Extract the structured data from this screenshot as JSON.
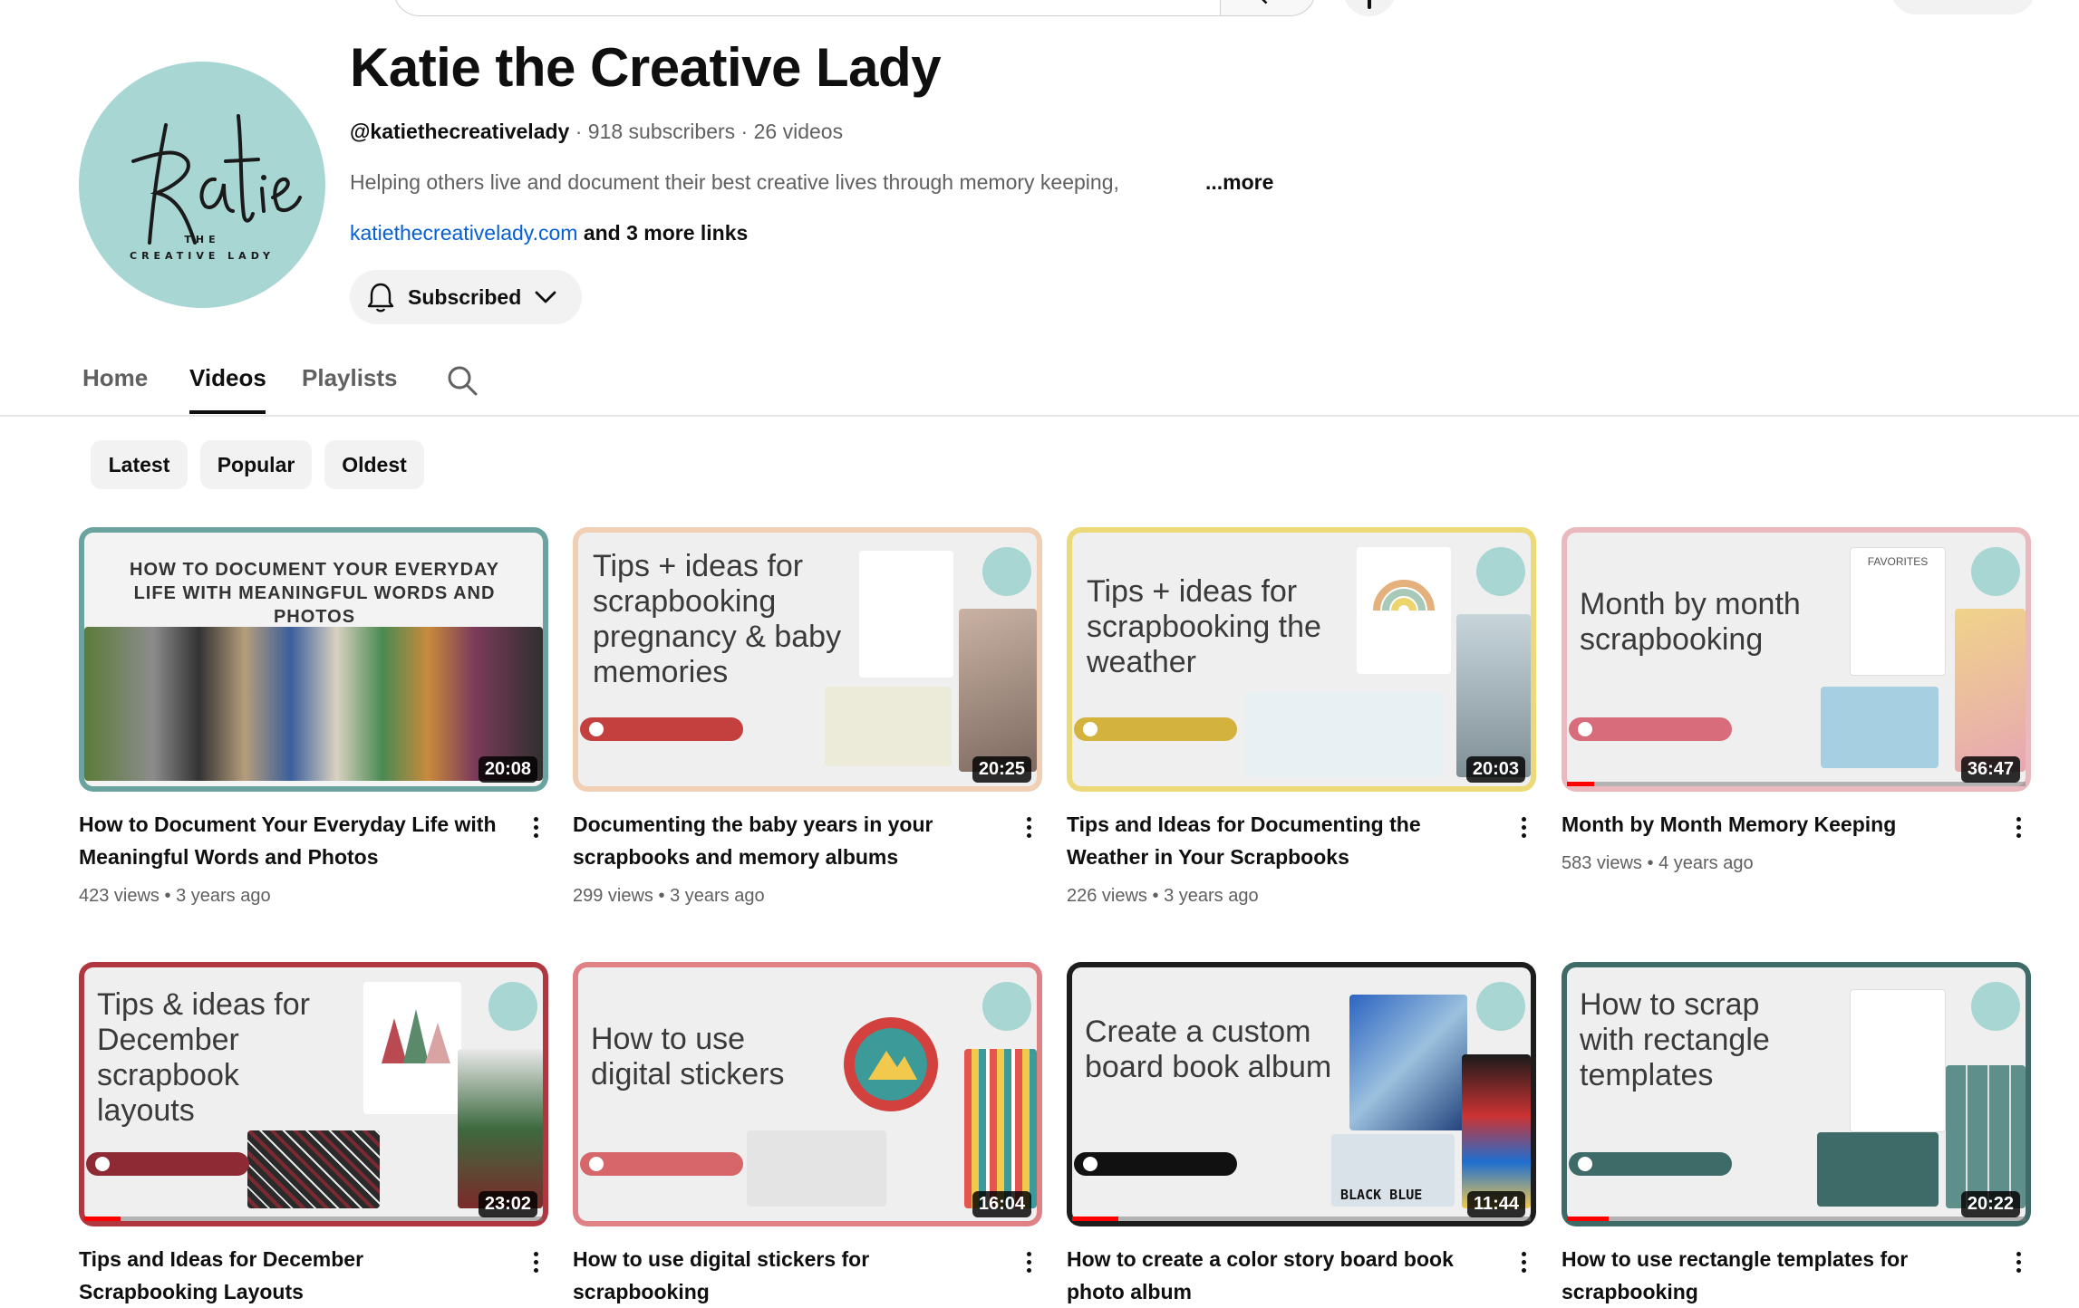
{
  "header": {
    "search_placeholder": ""
  },
  "channel": {
    "name": "Katie the Creative Lady",
    "handle": "@katiethecreativelady",
    "subscribers": "918 subscribers",
    "videos_count": "26 videos",
    "separator": "·",
    "description": "Helping others live and document their best creative lives through memory keeping,",
    "more_label": "...more",
    "link": "katiethecreativelady.com",
    "more_links": "and 3 more links",
    "avatar_tagline": "THE",
    "avatar_tagline2": "CREATIVE LADY",
    "subscribe_label": "Subscribed",
    "accent_color": "#a7d6d3"
  },
  "tabs": [
    {
      "label": "Home",
      "active": false
    },
    {
      "label": "Videos",
      "active": true
    },
    {
      "label": "Playlists",
      "active": false
    }
  ],
  "chips": [
    {
      "label": "Latest"
    },
    {
      "label": "Popular"
    },
    {
      "label": "Oldest"
    }
  ],
  "videos": [
    {
      "title": "How to Document Your Everyday Life with Meaningful Words and Photos",
      "views": "423 views",
      "age": "3 years ago",
      "duration": "20:08",
      "thumb_text": "HOW TO DOCUMENT YOUR EVERYDAY LIFE WITH MEANINGFUL WORDS AND PHOTOS",
      "frame_color": "#6aa39f"
    },
    {
      "title": "Documenting the baby years in your scrapbooks and memory albums",
      "views": "299 views",
      "age": "3 years ago",
      "duration": "20:25",
      "thumb_text": "Tips + ideas for scrapbooking pregnancy & baby memories",
      "frame_color": "#f1cfb4"
    },
    {
      "title": "Tips and Ideas for Documenting the Weather in Your Scrapbooks",
      "views": "226 views",
      "age": "3 years ago",
      "duration": "20:03",
      "thumb_text": "Tips + ideas for scrapbooking the weather",
      "frame_color": "#ecd97a"
    },
    {
      "title": "Month by Month Memory Keeping",
      "views": "583 views",
      "age": "4 years ago",
      "duration": "36:47",
      "thumb_text": "Month by month scrapbooking",
      "thumb_sub": "FAVORITES",
      "frame_color": "#eab9be",
      "progress": 0.06
    },
    {
      "title": "Tips and Ideas for December Scrapbooking Layouts",
      "views": "",
      "age": "",
      "duration": "23:02",
      "thumb_text": "Tips & ideas for December scrapbook layouts",
      "frame_color": "#b0363f",
      "progress": 0.08
    },
    {
      "title": "How to use digital stickers for scrapbooking",
      "views": "",
      "age": "",
      "duration": "16:04",
      "thumb_text": "How to use digital stickers",
      "frame_color": "#de8286"
    },
    {
      "title": "How to create a color story board book photo album",
      "views": "",
      "age": "",
      "duration": "11:44",
      "thumb_text": "Create a custom board book album",
      "thumb_sub": "BLACK BLUE",
      "frame_color": "#1d1d1d",
      "progress": 0.1
    },
    {
      "title": "How to use rectangle templates for scrapbooking",
      "views": "",
      "age": "",
      "duration": "20:22",
      "thumb_text": "How to scrap with rectangle templates",
      "frame_color": "#3e6b67",
      "progress": 0.09
    }
  ]
}
